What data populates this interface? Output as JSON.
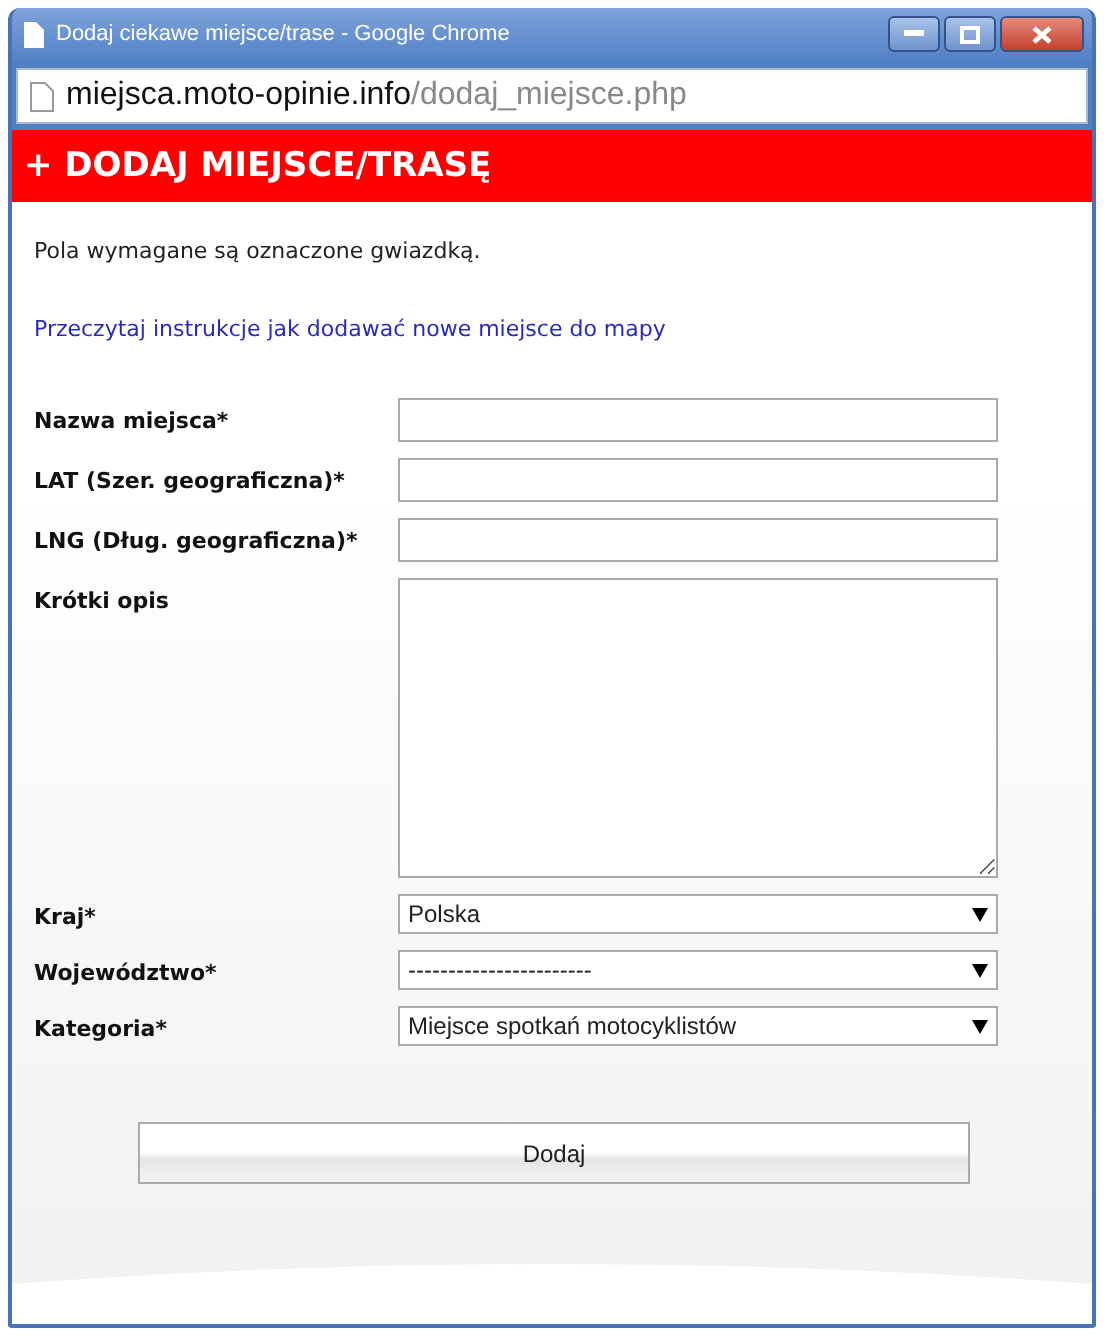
{
  "window": {
    "title": "Dodaj ciekawe miejsce/trase - Google Chrome"
  },
  "address_bar": {
    "host": "miejsca.moto-opinie.info",
    "path": "/dodaj_miejsce.php"
  },
  "header": {
    "title": "+ DODAJ MIEJSCE/TRASĘ"
  },
  "intro": "Pola wymagane są oznaczone gwiazdką.",
  "instructions_link": "Przeczytaj instrukcje jak dodawać nowe miejsce do mapy",
  "fields": [
    {
      "kind": "text",
      "label": "Nazwa miejsca*"
    },
    {
      "kind": "text",
      "label": "LAT (Szer. geograficzna)*"
    },
    {
      "kind": "text",
      "label": "LNG (Dług. geograficzna)*"
    },
    {
      "kind": "textarea",
      "label": "Krótki opis"
    },
    {
      "kind": "select",
      "label": "Kraj*",
      "value": "Polska"
    },
    {
      "kind": "select",
      "label": "Województwo*",
      "value": "-----------------------"
    },
    {
      "kind": "select",
      "label": "Kategoria*",
      "value": "Miejsce spotkań motocyklistów"
    }
  ],
  "submit": "Dodaj"
}
